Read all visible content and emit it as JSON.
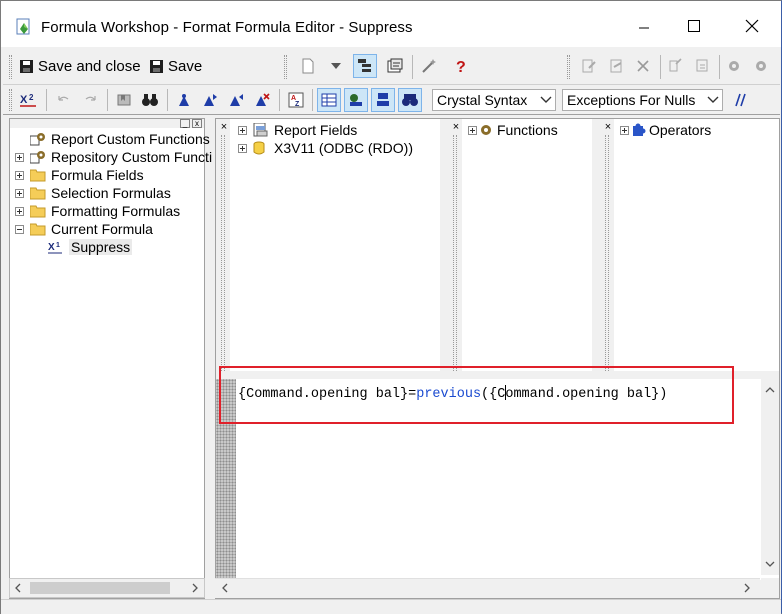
{
  "window": {
    "title": "Formula Workshop - Format Formula Editor - Suppress"
  },
  "toolbar": {
    "save_close_label": "Save and close",
    "save_label": "Save",
    "syntax_value": "Crystal Syntax",
    "null_handling_value": "Exceptions For Nulls"
  },
  "tree": {
    "items": [
      {
        "label": "Report Custom Functions",
        "icon": "custom-function-icon",
        "expandable": false
      },
      {
        "label": "Repository Custom Functi",
        "icon": "custom-function-icon",
        "expandable": true
      },
      {
        "label": "Formula Fields",
        "icon": "folder-icon",
        "expandable": true
      },
      {
        "label": "Selection Formulas",
        "icon": "folder-icon",
        "expandable": true
      },
      {
        "label": "Formatting Formulas",
        "icon": "folder-icon",
        "expandable": true
      },
      {
        "label": "Current Formula",
        "icon": "folder-icon",
        "expandable": true
      }
    ],
    "current": {
      "label": "Suppress",
      "icon": "formula-icon"
    }
  },
  "fields_pane": {
    "items": [
      {
        "label": "Report Fields",
        "icon": "report-fields-icon"
      },
      {
        "label": "X3V11 (ODBC (RDO))",
        "icon": "database-icon"
      }
    ]
  },
  "functions_pane": {
    "label": "Functions",
    "icon": "gear-icon"
  },
  "operators_pane": {
    "label": "Operators",
    "icon": "puzzle-icon"
  },
  "editor": {
    "part1": "{Command.opening bal}=",
    "keyword": "previous",
    "part2": "({C",
    "part3": "ommand.opening bal})"
  },
  "icons": {
    "accent_blue": "#1a4ad0",
    "highlight_red": "#e0202a",
    "folder_yellow": "#f5cd58"
  }
}
